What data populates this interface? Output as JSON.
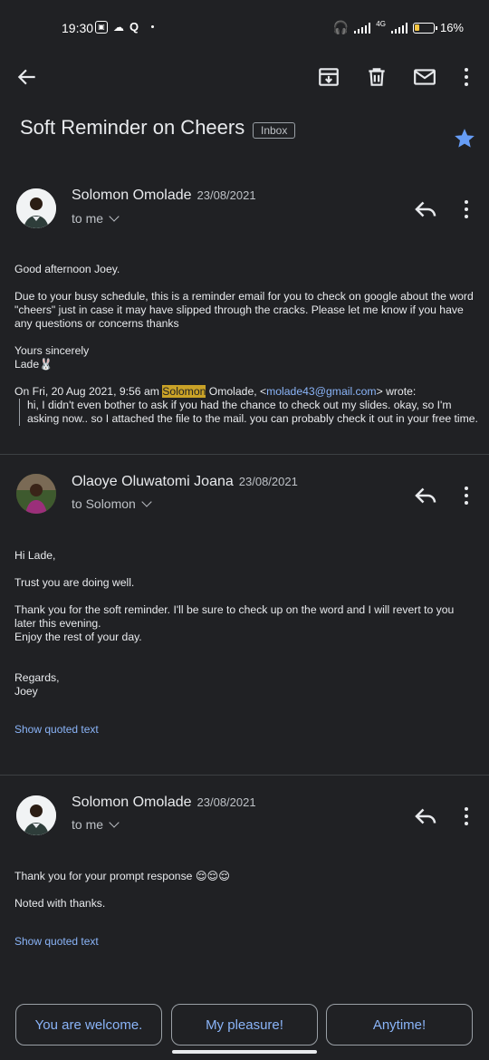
{
  "status_bar": {
    "time": "19:30",
    "network": "4G",
    "battery": "16%"
  },
  "toolbar": {
    "back_icon": "arrow-back-icon",
    "archive_icon": "archive-icon",
    "delete_icon": "delete-icon",
    "mark_unread_icon": "mail-icon",
    "more_icon": "more-vert-icon"
  },
  "subject": {
    "title": "Soft Reminder on Cheers",
    "label": "Inbox",
    "starred": true,
    "star_color": "#669df6"
  },
  "messages": [
    {
      "sender": "Solomon Omolade",
      "date": "23/08/2021",
      "to": "to me",
      "greeting": "Good afternoon Joey.",
      "para1": "Due to your busy schedule, this is a reminder email for you to check on google about the word \"cheers\" just in case it may have slipped through the cracks. Please let me know if you have any questions or concerns thanks",
      "sign1": "Yours sincerely",
      "sign2": "Lade🐰",
      "quote_intro_a": "On Fri, 20 Aug 2021, 9:56 am ",
      "quote_intro_hl": "Solomon",
      "quote_intro_b": " Omolade, <",
      "quote_email": "molade43@gmail.com",
      "quote_intro_c": "> wrote:",
      "quote_text": "hi, I didn't even bother to ask if you had the chance to check out my slides. okay, so I'm asking now.. so I attached the file to the mail. you can probably check it out in your free time."
    },
    {
      "sender": "Olaoye Oluwatomi Joana",
      "date": "23/08/2021",
      "to": "to Solomon",
      "greeting": "Hi Lade,",
      "para1": "Trust you are doing well.",
      "para2a": "Thank you for the soft reminder. I'll be sure to check up on the word and I will revert to you later this evening.",
      "para2b": "Enjoy the rest of your day.",
      "sign1": "Regards,",
      "sign2": "Joey",
      "show_quoted": "Show quoted text"
    },
    {
      "sender": "Solomon Omolade",
      "date": "23/08/2021",
      "to": "to me",
      "para1": "Thank you for your prompt response 😌😌😌",
      "para2": "Noted with thanks.",
      "show_quoted": "Show quoted text"
    }
  ],
  "smart_replies": [
    "You are welcome.",
    "My pleasure!",
    "Anytime!"
  ]
}
